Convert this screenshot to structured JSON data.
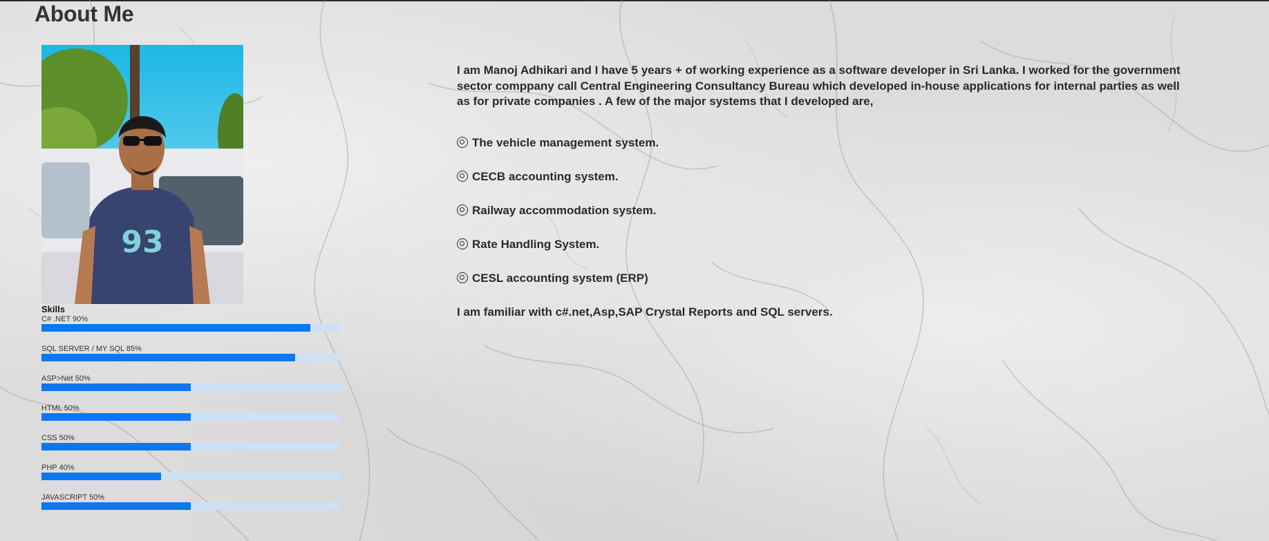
{
  "page": {
    "title": "About Me"
  },
  "profile_photo": {
    "icon": "profile-photo",
    "description_visible": false
  },
  "skills": {
    "title": "Skills",
    "accent_color": "#0b78f0",
    "track_color": "#cde1f6",
    "items": [
      {
        "label": "C# .NET 90%",
        "percent": 90
      },
      {
        "label": "SQL SERVER / MY SQL 85%",
        "percent": 85
      },
      {
        "label": "ASP>Net 50%",
        "percent": 50
      },
      {
        "label": "HTML 50%",
        "percent": 50
      },
      {
        "label": "CSS 50%",
        "percent": 50
      },
      {
        "label": "PHP 40%",
        "percent": 40
      },
      {
        "label": "JAVASCRIPT 50%",
        "percent": 50
      }
    ]
  },
  "bio": {
    "intro": "I am Manoj Adhikari and I have 5 years + of working experience as a software developer in Sri Lanka. I worked for the government sector comppany call Central Engineering Consultancy Bureau which developed in-house applications for internal parties as well as for private companies . A few of the major systems that I developed are,",
    "bullet_icon": "circle-bullet-icon",
    "systems": [
      "The vehicle management system.",
      "CECB accounting system.",
      "Railway accommodation system.",
      "Rate Handling System.",
      "CESL accounting system (ERP)"
    ],
    "outro": "I am familiar with c#.net,Asp,SAP Crystal Reports and SQL servers."
  }
}
